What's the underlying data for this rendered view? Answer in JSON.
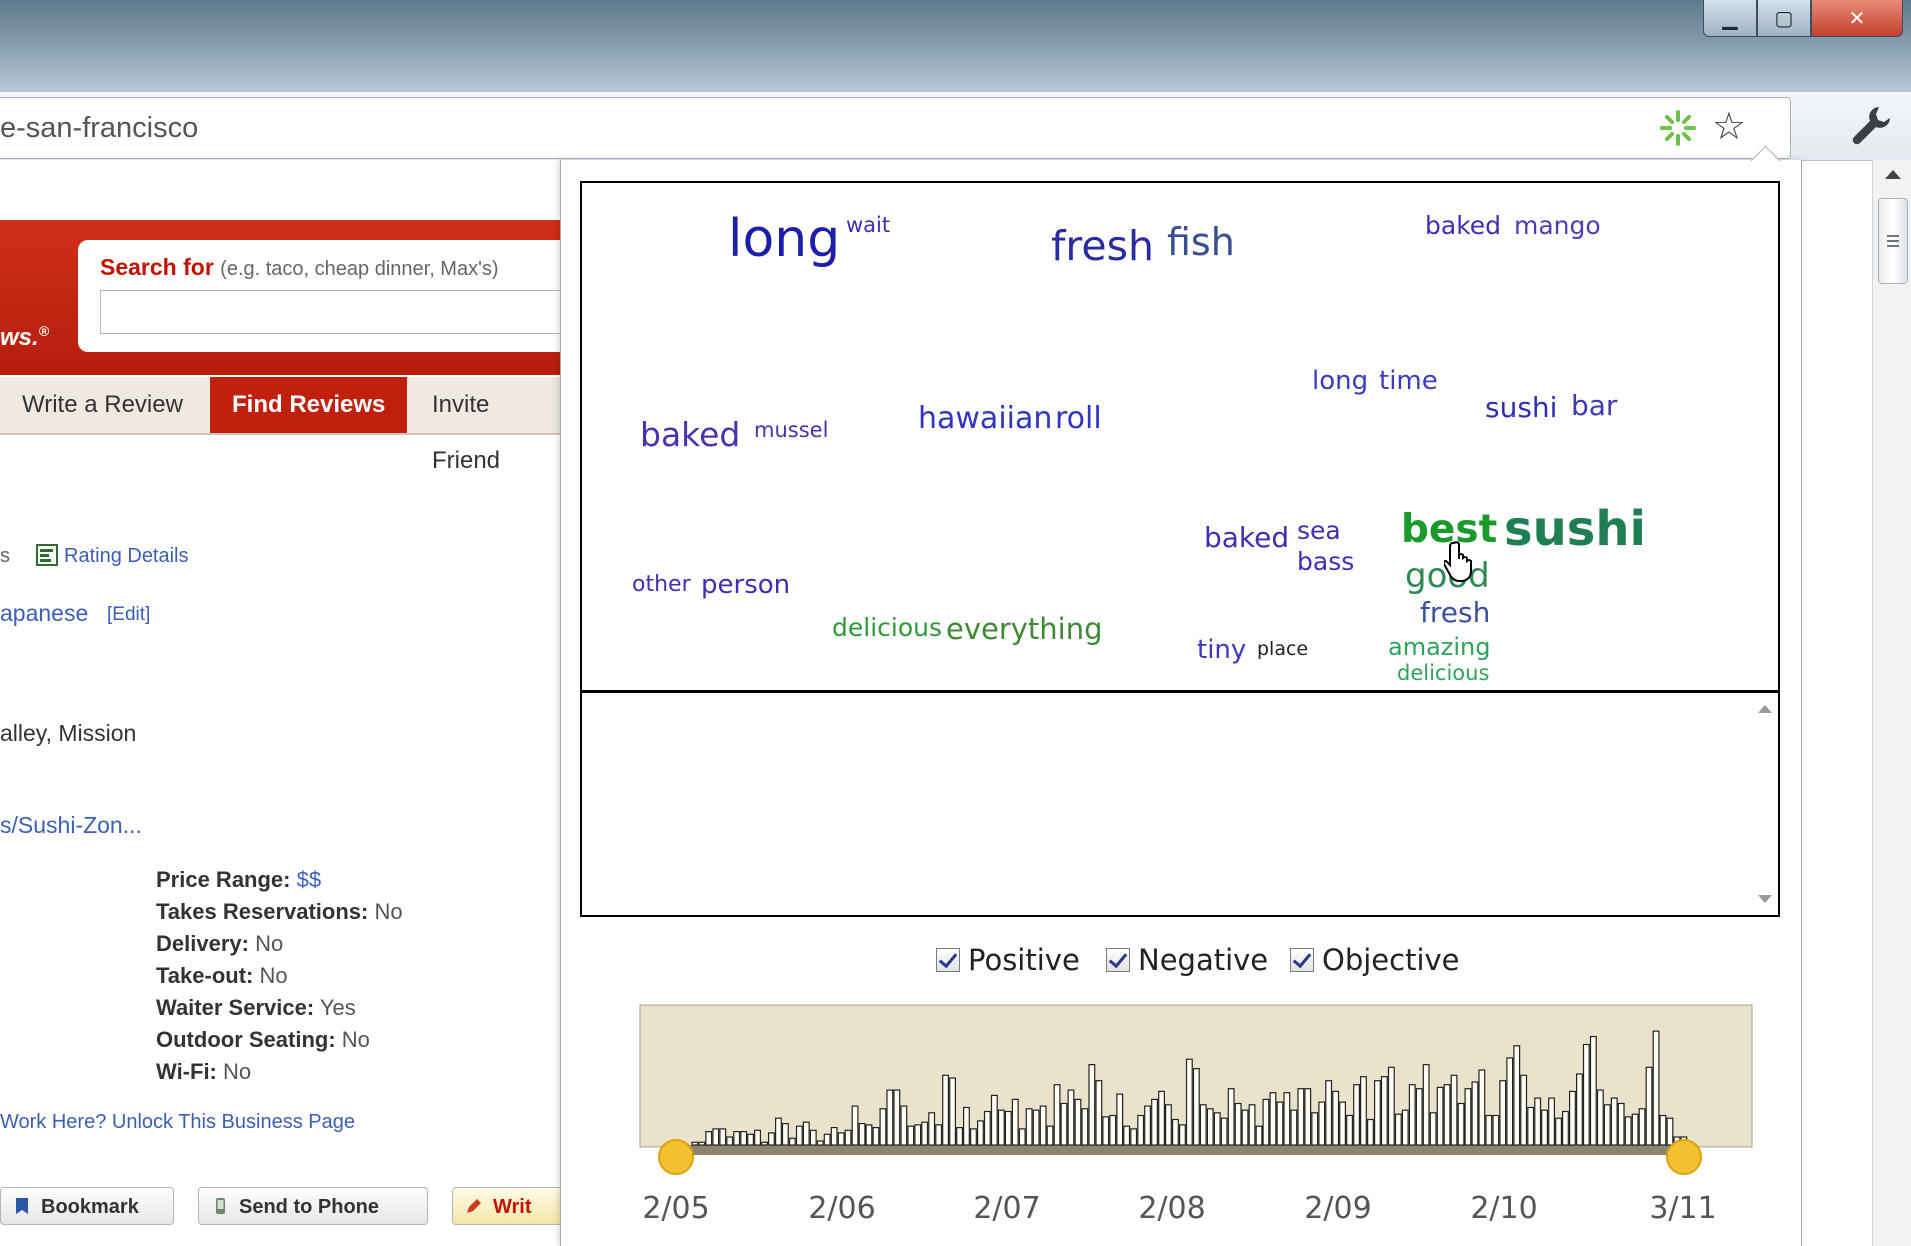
{
  "browser": {
    "url_visible": "e-san-francisco",
    "window_buttons": {
      "minimize": "▁",
      "maximize": "▢",
      "close": "✕"
    },
    "icons": [
      "loading-spinner-icon",
      "star-icon",
      "wrench-icon"
    ]
  },
  "yelp": {
    "logo_tail": "ws.",
    "logo_reg": "®",
    "search_for": "Search for",
    "search_hint": "(e.g. taco, cheap dinner, Max's)",
    "nav": [
      "Write a Review",
      "Find Reviews",
      "Invite Friend"
    ],
    "rating_prefix": "s",
    "rating_details": "Rating Details",
    "category": "apanese",
    "edit": "[Edit]",
    "neighborhood": "alley, Mission",
    "website": "s/Sushi-Zon...",
    "attributes": [
      {
        "label": "Price Range:",
        "value": "$$"
      },
      {
        "label": "Takes Reservations:",
        "value": "No"
      },
      {
        "label": "Delivery:",
        "value": "No"
      },
      {
        "label": "Take-out:",
        "value": "No"
      },
      {
        "label": "Waiter Service:",
        "value": "Yes"
      },
      {
        "label": "Outdoor Seating:",
        "value": "No"
      },
      {
        "label": "Wi-Fi:",
        "value": "No"
      }
    ],
    "work_here": "Work Here? Unlock This Business Page",
    "buttons": {
      "bookmark": "Bookmark",
      "send_to_phone": "Send to Phone",
      "write": "Writ"
    }
  },
  "colors": {
    "positive": "#1a9a2a",
    "objective": "#3e2fb4",
    "negative_blue": "#1d1fa8",
    "timeline_bg": "#ebe2cb",
    "handle": "#f2c12e"
  },
  "word_cloud": {
    "phrases": [
      {
        "words": [
          "long",
          "wait"
        ]
      },
      {
        "words": [
          "fresh",
          "fish"
        ]
      },
      {
        "words": [
          "baked",
          "mango"
        ]
      },
      {
        "words": [
          "long",
          "time"
        ]
      },
      {
        "words": [
          "sushi",
          "bar"
        ]
      },
      {
        "words": [
          "baked",
          "mussel"
        ]
      },
      {
        "words": [
          "hawaiian",
          "roll"
        ]
      },
      {
        "words": [
          "baked",
          "sea bass"
        ]
      },
      {
        "words": [
          "best",
          "sushi"
        ]
      },
      {
        "words": [
          "good",
          "fresh",
          "amazing",
          "delicious"
        ]
      },
      {
        "words": [
          "other",
          "person"
        ]
      },
      {
        "words": [
          "delicious",
          "everything"
        ]
      },
      {
        "words": [
          "tiny",
          "place"
        ]
      }
    ]
  },
  "filters": [
    {
      "label": "Positive",
      "checked": true
    },
    {
      "label": "Negative",
      "checked": true
    },
    {
      "label": "Objective",
      "checked": true
    }
  ],
  "chart_data": {
    "type": "bar",
    "x_tick_labels": [
      "2/05",
      "2/06",
      "2/07",
      "2/08",
      "2/09",
      "2/10",
      "3/11"
    ],
    "range_selection": [
      "2/05",
      "3/11"
    ],
    "values": [
      2,
      2,
      10,
      12,
      12,
      6,
      10,
      10,
      8,
      11,
      2,
      9,
      20,
      16,
      5,
      14,
      17,
      11,
      3,
      8,
      13,
      9,
      11,
      29,
      16,
      15,
      13,
      27,
      41,
      41,
      29,
      14,
      15,
      17,
      24,
      15,
      52,
      50,
      13,
      28,
      12,
      18,
      25,
      37,
      26,
      25,
      34,
      12,
      27,
      26,
      29,
      14,
      45,
      31,
      41,
      34,
      27,
      60,
      48,
      21,
      22,
      38,
      14,
      12,
      22,
      29,
      34,
      40,
      30,
      19,
      15,
      64,
      57,
      30,
      27,
      24,
      20,
      42,
      31,
      26,
      30,
      14,
      34,
      39,
      32,
      39,
      26,
      42,
      42,
      24,
      32,
      48,
      40,
      32,
      22,
      45,
      51,
      19,
      48,
      51,
      58,
      23,
      26,
      45,
      42,
      60,
      24,
      43,
      45,
      52,
      31,
      42,
      47,
      56,
      22,
      22,
      48,
      65,
      74,
      52,
      28,
      35,
      26,
      35,
      20,
      25,
      40,
      53,
      75,
      81,
      41,
      30,
      35,
      31,
      21,
      23,
      27,
      58,
      85,
      22,
      20,
      6,
      6
    ]
  }
}
